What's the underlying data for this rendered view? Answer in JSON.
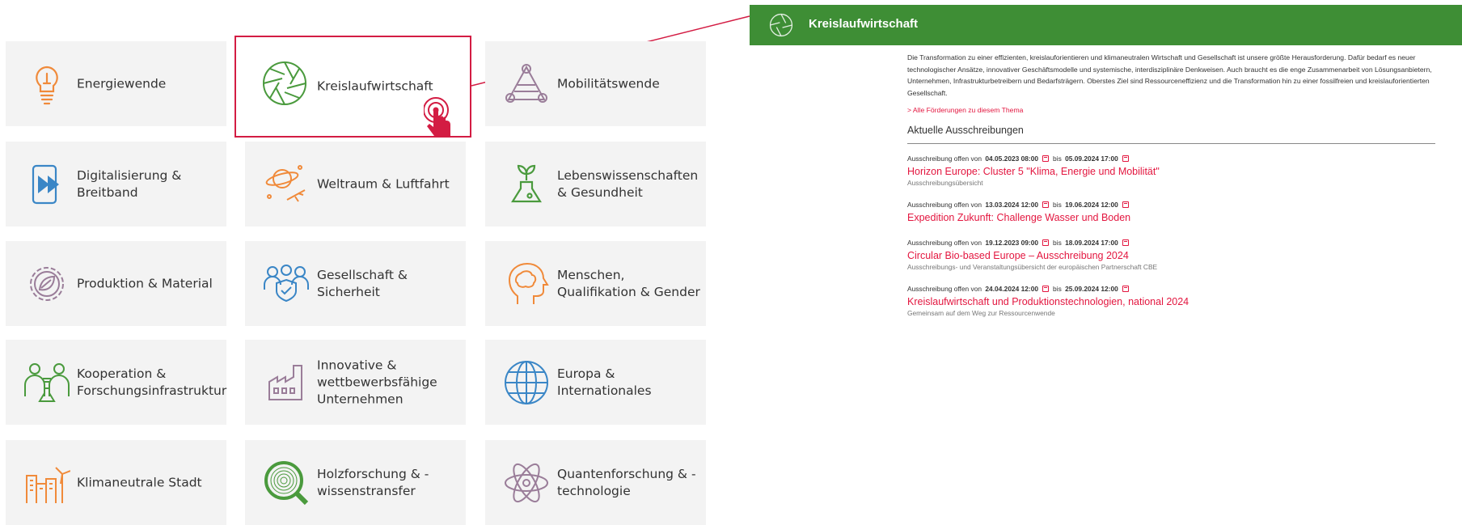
{
  "tiles": [
    {
      "label": "Energiewende",
      "icon": "lightbulb-icon"
    },
    {
      "label": "Kreislaufwirtschaft",
      "icon": "circular-aperture-icon"
    },
    {
      "label": "Mobilitätswende",
      "icon": "mobility-network-icon"
    },
    {
      "label": "Digitalisierung &\nBreitband",
      "icon": "tablet-fast-forward-icon"
    },
    {
      "label": "Weltraum & Luftfahrt",
      "icon": "planet-airplane-icon"
    },
    {
      "label": "Lebenswissenschaften\n& Gesundheit",
      "icon": "flask-plant-icon"
    },
    {
      "label": "Produktion & Material",
      "icon": "gear-leaf-icon"
    },
    {
      "label": "Gesellschaft &\nSicherheit",
      "icon": "people-shield-icon"
    },
    {
      "label": "Menschen,\nQualifikation & Gender",
      "icon": "head-brain-icon"
    },
    {
      "label": "Kooperation &\nForschungsinfrastruktur",
      "icon": "collaboration-lab-icon"
    },
    {
      "label": "Innovative &\nwettbewerbsfähige\nUnternehmen",
      "icon": "factory-icon"
    },
    {
      "label": "Europa &\nInternationales",
      "icon": "globe-icon"
    },
    {
      "label": "Klimaneutrale Stadt",
      "icon": "city-windturbine-icon"
    },
    {
      "label": "Holzforschung & -\nwissenstransfer",
      "icon": "wood-magnifier-icon"
    },
    {
      "label": "Quantenforschung & -\ntechnologie",
      "icon": "atom-icon"
    }
  ],
  "panel": {
    "title": "Kreislaufwirtschaft",
    "description": "Die Transformation zu einer effizienten, kreislauforientieren und klimaneutralen Wirtschaft und Gesellschaft ist unsere größte Herausforderung. Dafür bedarf es neuer technologischer Ansätze, innovativer Geschäftsmodelle und systemische, interdisziplinäre Denkweisen. Auch braucht es die enge Zusammenarbeit von Lösungsanbietern, Unternehmen, Infrastrukturbetreibern und Bedarfsträgern. Oberstes Ziel sind Ressourceneffizienz und die Transformation hin zu einer fossilfreien und kreislauforientierten Gesellschaft.",
    "all_link": "> Alle Förderungen zu diesem Thema",
    "section_title": "Aktuelle Ausschreibungen",
    "meta_open": "Ausschreibung offen von",
    "meta_to": "bis",
    "entries": [
      {
        "start": "04.05.2023 08:00",
        "end": "05.09.2024 17:00",
        "title": "Horizon Europe: Cluster 5 \"Klima, Energie und Mobilität\"",
        "subtitle": "Ausschreibungsübersicht"
      },
      {
        "start": "13.03.2024 12:00",
        "end": "19.06.2024 12:00",
        "title": "Expedition Zukunft: Challenge Wasser und Boden",
        "subtitle": ""
      },
      {
        "start": "19.12.2023 09:00",
        "end": "18.09.2024 17:00",
        "title": "Circular Bio-based Europe – Ausschreibung 2024",
        "subtitle": "Ausschreibungs- und Veranstaltungsübersicht der europäischen Partnerschaft CBE"
      },
      {
        "start": "24.04.2024 12:00",
        "end": "25.09.2024 12:00",
        "title": "Kreislaufwirtschaft und Produktionstechnologien, national 2024",
        "subtitle": "Gemeinsam auf dem Weg zur Ressourcenwende"
      }
    ]
  },
  "colors": {
    "accent_red": "#e3163f",
    "header_green": "#3e8e35",
    "tile_bg": "#f3f3f3"
  }
}
